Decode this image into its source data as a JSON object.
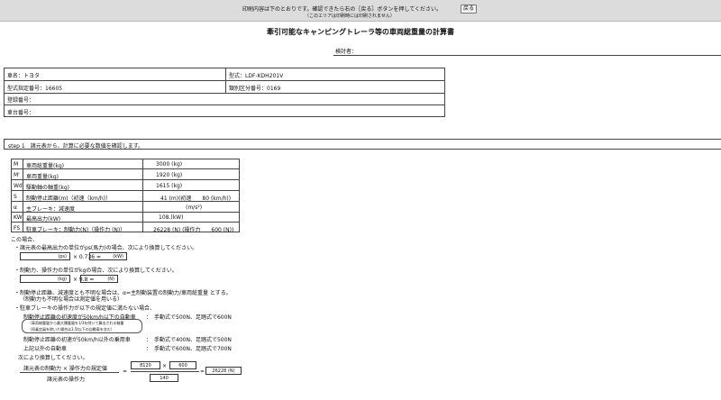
{
  "topbar": {
    "instruction": "印刷内容は下のとおりです。確認できたら右の［戻る］ボタンを押してください。",
    "note": "（このエリアは印刷時には印刷されません）",
    "back_button": "戻る"
  },
  "document": {
    "title": "牽引可能なキャンピングトレーラ等の車両総重量の計算書",
    "reviewer_label": "検討者："
  },
  "vehicle_info": {
    "maker": "車名：トヨタ",
    "model": "型式：LDF-KDH201V",
    "type_designation": "型式指定番号：16605",
    "category": "類別区分番号：0169",
    "registration": "登録番号：",
    "chassis": "車台番号："
  },
  "step1": {
    "label": "step 1　諸元表から、計算に必要な数値を確認します。"
  },
  "spec_table": {
    "rows": [
      {
        "sym": "M",
        "label": "車両総重量(kg)",
        "value": "3000 (kg)"
      },
      {
        "sym": "M'",
        "label": "車両重量(kg)",
        "value": "1920 (kg)"
      },
      {
        "sym": "Wd",
        "label": "駆動軸の軸重(kg)",
        "value": "1615 (kg)"
      },
      {
        "sym": "S",
        "label": "制動停止距離(m)（初速（km/h)）",
        "value": "41 (m)(初速　　80 (km/h))"
      },
      {
        "sym": "α",
        "label": "主ブレーキ：減速度",
        "value": "(m/s²)"
      },
      {
        "sym": "KW",
        "label": "最高出力(kW)",
        "value": "108.(kW)"
      },
      {
        "sym": "FS",
        "label": "駐車ブレーキ：制動力(N)（操作力 (N)）",
        "value": "26228 (N) (操作力　　600 (N))"
      }
    ]
  },
  "notes": {
    "intro": "この場合、",
    "ps_note": "・諸元表の最高出力の単位がps(馬力)の場合、次により換算してください。",
    "ps_unit": "(ps)",
    "ps_factor": "× 0.736 =",
    "ps_result_unit": "(kW)",
    "kg_note": "・制動力、操作力の単位がkgの場合、次により換算してください。",
    "kg_unit": "(kg)",
    "kg_factor": "× 9.8 =",
    "kg_result_unit": "(N)",
    "brake_note": "・制動停止距離、減速度とも不明な場合は、α=主制動装置の制動力/車両総重量 とする。",
    "brake_note2": "（制動力も不明な場合は測定値を用いる）",
    "parking_note": "・駐車ブレーキの操作力が以下の規定値に満たない場合、",
    "cond1_label": "制動停止距離の初速度が50km/h以下の自動車",
    "cond1_value": "：　手動式で500N、足踏式で600N",
    "cond1_sub1": "（車両総重量から最大積載量を1/3を除いて算出される軸重",
    "cond1_sub2": "（同乗定員を除いた場合は3.5t以下の自動車を含む）",
    "cond2_label": "制動停止距離の初速が50km/h以外の乗用車",
    "cond2_value": "：　手動式で400N、足踏式で500N",
    "cond3_label": "上記以外の自動車",
    "cond3_value": "：　手動式で600N、足踏式で700N",
    "conversion_note": "次により換算してください。",
    "formula_numerator": "諸元表の制動力 × 操作力の規定値",
    "formula_denominator": "諸元表の操作力",
    "val_force": "8120",
    "times": "×",
    "val_regulation": "600",
    "equals": "=",
    "val_operation": "140",
    "val_result": "26228 (N)"
  }
}
